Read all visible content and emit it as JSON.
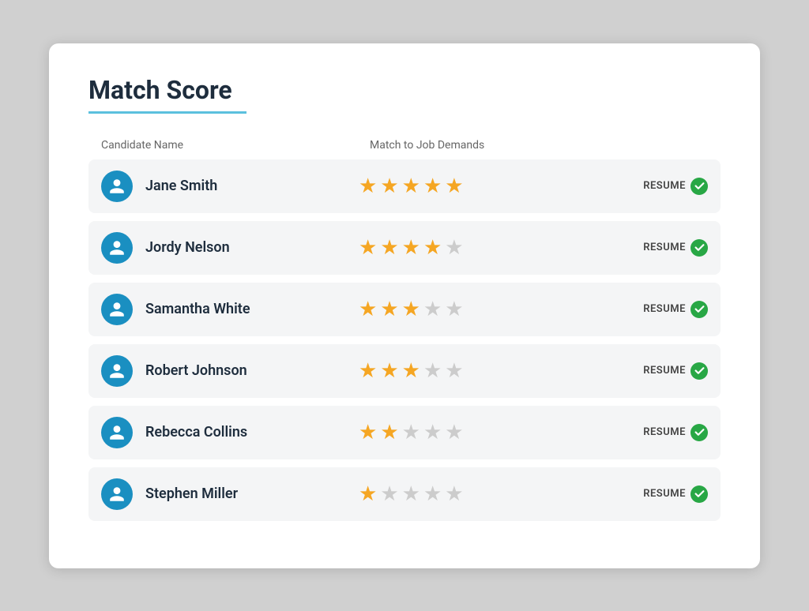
{
  "title": "Match Score",
  "underline_color": "#5bc0de",
  "columns": {
    "name": "Candidate Name",
    "match": "Match to Job Demands"
  },
  "candidates": [
    {
      "id": 1,
      "name": "Jane Smith",
      "stars_filled": 5,
      "stars_total": 5,
      "resume_label": "RESUME"
    },
    {
      "id": 2,
      "name": "Jordy Nelson",
      "stars_filled": 4,
      "stars_total": 5,
      "resume_label": "RESUME"
    },
    {
      "id": 3,
      "name": "Samantha White",
      "stars_filled": 3,
      "stars_total": 5,
      "resume_label": "RESUME"
    },
    {
      "id": 4,
      "name": "Robert Johnson",
      "stars_filled": 3,
      "stars_total": 5,
      "resume_label": "RESUME"
    },
    {
      "id": 5,
      "name": "Rebecca Collins",
      "stars_filled": 2,
      "stars_total": 5,
      "resume_label": "RESUME"
    },
    {
      "id": 6,
      "name": "Stephen Miller",
      "stars_filled": 1,
      "stars_total": 5,
      "resume_label": "RESUME"
    }
  ]
}
